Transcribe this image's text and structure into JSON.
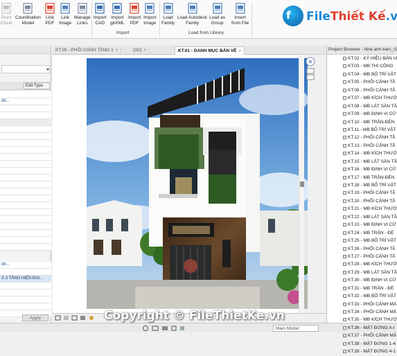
{
  "ribbon": {
    "buttons": [
      {
        "label": "Point\nCloud",
        "name": "point-cloud-button",
        "icon": "point-cloud-icon",
        "dim": true
      },
      {
        "label": "Coordination\nModel",
        "name": "coordination-model-button",
        "icon": "coordination-model-icon"
      },
      {
        "label": "Link\nPDF",
        "name": "link-pdf-button",
        "icon": "pdf-icon"
      },
      {
        "label": "Link\nImage",
        "name": "link-image-button",
        "icon": "image-icon"
      },
      {
        "label": "Manage\nLinks",
        "name": "manage-links-button",
        "icon": "manage-links-icon"
      },
      {
        "label": "Import\nCAD",
        "name": "import-cad-button",
        "icon": "cad-icon"
      },
      {
        "label": "Import\ngbXML",
        "name": "import-gbxml-button",
        "icon": "gbxml-icon"
      },
      {
        "label": "Import\nPDF",
        "name": "import-pdf-button",
        "icon": "pdf-icon"
      },
      {
        "label": "Import\nImage",
        "name": "import-image-button",
        "icon": "image-icon"
      },
      {
        "label": "Load\nFamily",
        "name": "load-family-button",
        "icon": "load-family-icon"
      },
      {
        "label": "Load Autodesk\nFamily",
        "name": "load-autodesk-family-button",
        "icon": "autodesk-family-icon"
      },
      {
        "label": "Load as\nGroup",
        "name": "load-as-group-button",
        "icon": "group-icon"
      },
      {
        "label": "Insert\nfrom File",
        "name": "insert-from-file-button",
        "icon": "insert-file-icon"
      }
    ],
    "groups": {
      "import": "Import",
      "load": "Load from Library"
    }
  },
  "logo": {
    "text_a": "File",
    "text_b": "Thiết Kế",
    "text_c": ".vn"
  },
  "left_panel": {
    "edit_type": "Edit Type",
    "rows_top": [
      "",
      "dit...",
      "",
      "",
      "",
      "",
      "",
      "",
      "",
      "",
      "",
      "",
      "",
      "",
      "",
      "",
      "",
      "",
      "",
      "",
      "",
      "",
      ""
    ],
    "rows_bottom": [
      "dit...",
      "",
      "À 3 TẦNG HIỆN ĐẠI...",
      "",
      "",
      "",
      "",
      ""
    ],
    "apply": "Apply"
  },
  "tabs": [
    {
      "label": "KT.05 - PHỐI CẢNH TẦNG 1",
      "active": false
    },
    {
      "label": "{3D}",
      "active": false
    },
    {
      "label": "KT.01 - DANH MỤC BẢN VẼ",
      "active": true
    }
  ],
  "status": {
    "main_model": "Main Model"
  },
  "watermark": {
    "copyright": "Copyright © FileThietKe.vn"
  },
  "browser": {
    "title": "Project Browser - Nha anh kien_r1",
    "items": [
      "KT.02 - KÝ HIỆU BẢN VẼ",
      "KT.03 - MB THI CÔNG",
      "KT.04 - MB BỐ TRÍ VẬT",
      "KT.05 - PHỐI CẢNH TẦ",
      "KT.06 - PHỐI CẢNH TẦ",
      "KT.07 - MB KÍCH THƯỚ",
      "KT.08 - MB LÁT SÀN TẦ",
      "KT.09 - MB ĐỊNH VỊ CỬ",
      "KT.10 - MB TRẦN-ĐÈN",
      "KT.11 - MB BỐ TRÍ VẬT",
      "KT.12 - PHỐI CẢNH TẦ",
      "KT.13 - PHỐI CẢNH TẦ",
      "KT.14 - MB KÍCH THƯỚ",
      "KT.15 - MB LÁT SÀN TẦ",
      "KT.16 - MB ĐỊNH VỊ CỬ",
      "KT.17 - MB TRẦN-ĐÈN",
      "KT.18 - MB BỐ TRÍ VẬT",
      "KT.19 - PHỐI CẢNH TẦ",
      "KT.20 - PHỐI CẢNH TẦ",
      "KT.21 - MB KÍCH THƯỚ",
      "KT.22 - MB LÁT SÀN TẦ",
      "KT.23 - MB ĐỊNH VỊ CỬ",
      "KT.24 - MB TRẦN - ĐÈ",
      "KT.25 - MB BỐ TRÍ VẬT",
      "KT.26 - PHỐI CẢNH TẦ",
      "KT.27 - PHỐI CẢNH TẦ",
      "KT.28 - MB KÍCH THƯỚ",
      "KT.29 - MB LÁT SÀN TẦ",
      "KT.30 - MB ĐỊNH VỊ CỬ",
      "KT.31 - MB TRẦN - ĐÈ",
      "KT.32 - MB BỐ TRÍ VẬT",
      "KT.33 - PHỐI CẢNH MÁ",
      "KT.34 - PHỐI CẢNH MÁ",
      "KT.35 - MB KÍCH THƯỚ",
      "KT.36 - MẶT ĐỨNG A-I",
      "KT.37 - PHỐI CẢNH MẶ",
      "KT.38 - MẶT ĐỨNG 1-4",
      "KT.39 - MẶT ĐỨNG 4-1"
    ]
  },
  "colors": {
    "accent": "#1e88d8",
    "brand_red": "#e0412f",
    "tab_active": "#ffffff"
  }
}
